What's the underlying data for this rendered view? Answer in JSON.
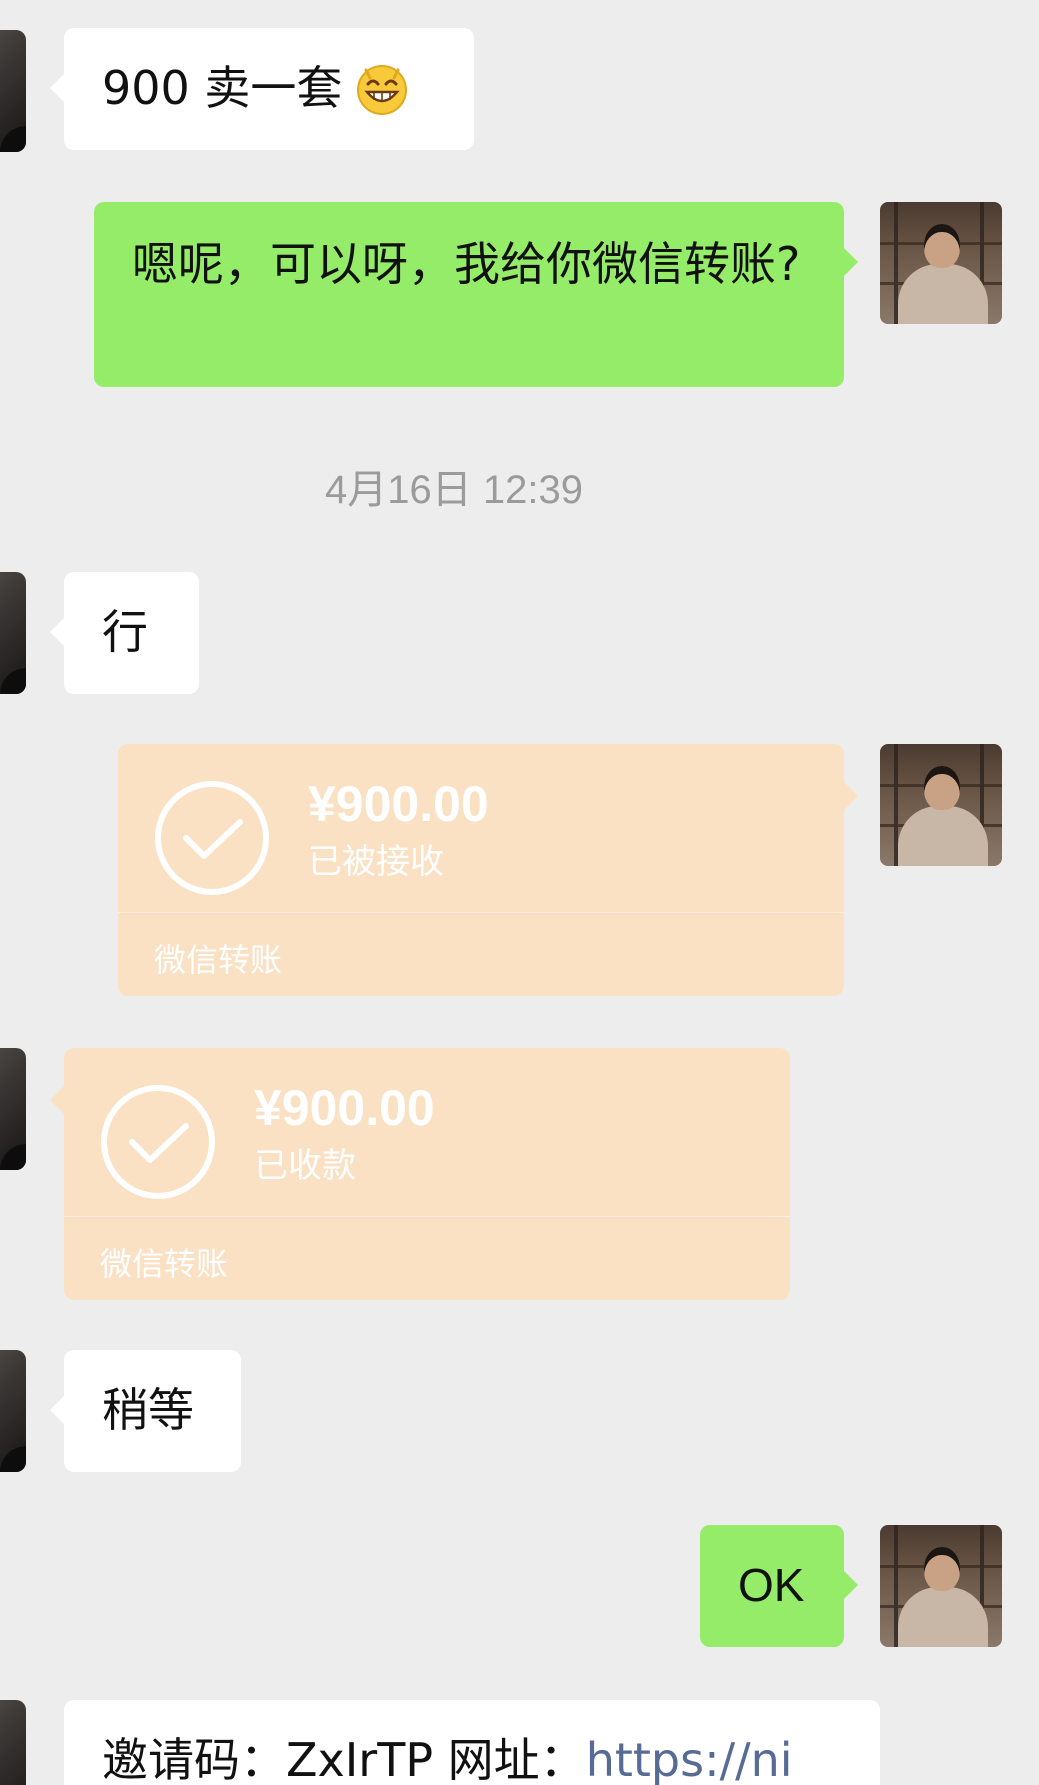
{
  "messages": {
    "m1": {
      "text": "900 卖一套",
      "emoji_icon": "grinning-face-icon"
    },
    "m2": {
      "text": "嗯呢，可以呀，我给你微信转账?"
    },
    "timestamp": "4月16日 12:39",
    "m3": {
      "text": "行"
    },
    "transfer1": {
      "amount": "¥900.00",
      "status": "已被接收",
      "label": "微信转账",
      "icon": "check-circle-icon"
    },
    "transfer2": {
      "amount": "¥900.00",
      "status": "已收款",
      "label": "微信转账",
      "icon": "check-circle-icon"
    },
    "m4": {
      "text": "稍等"
    },
    "m5": {
      "text": "OK"
    },
    "m6": {
      "prefix": "邀请码：ZxIrTP 网址：",
      "link": "https://ni"
    }
  },
  "colors": {
    "background": "#ededed",
    "incoming_bubble": "#ffffff",
    "outgoing_bubble": "#95ec69",
    "transfer_card": "#fbe1c4",
    "timestamp_text": "#9b9b9b",
    "link": "#576b95"
  }
}
